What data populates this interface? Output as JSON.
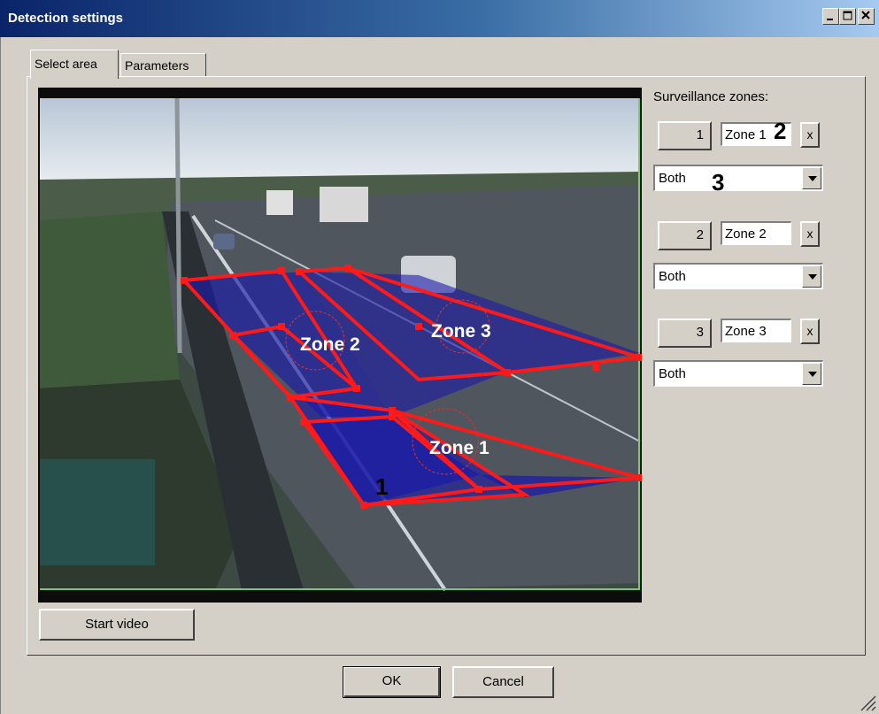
{
  "window": {
    "title": "Detection settings"
  },
  "tabs": [
    {
      "label": "Select area",
      "active": true
    },
    {
      "label": "Parameters",
      "active": false
    }
  ],
  "video": {
    "zones_overlay": [
      {
        "label": "Zone 1"
      },
      {
        "label": "Zone 2"
      },
      {
        "label": "Zone 3"
      }
    ],
    "overlay_colors": {
      "zone_fill": "#1a1aa8",
      "zone_outline": "#ff1a1a",
      "frame_border": "#7bcf4a"
    }
  },
  "start_video_label": "Start video",
  "surveillance": {
    "label": "Surveillance zones:",
    "zones": [
      {
        "number": "1",
        "name": "Zone 1",
        "remove": "x",
        "direction": "Both"
      },
      {
        "number": "2",
        "name": "Zone 2",
        "remove": "x",
        "direction": "Both"
      },
      {
        "number": "3",
        "name": "Zone 3",
        "remove": "x",
        "direction": "Both"
      }
    ]
  },
  "callouts": [
    "1",
    "2",
    "3"
  ],
  "footer": {
    "ok_label": "OK",
    "cancel_label": "Cancel"
  }
}
